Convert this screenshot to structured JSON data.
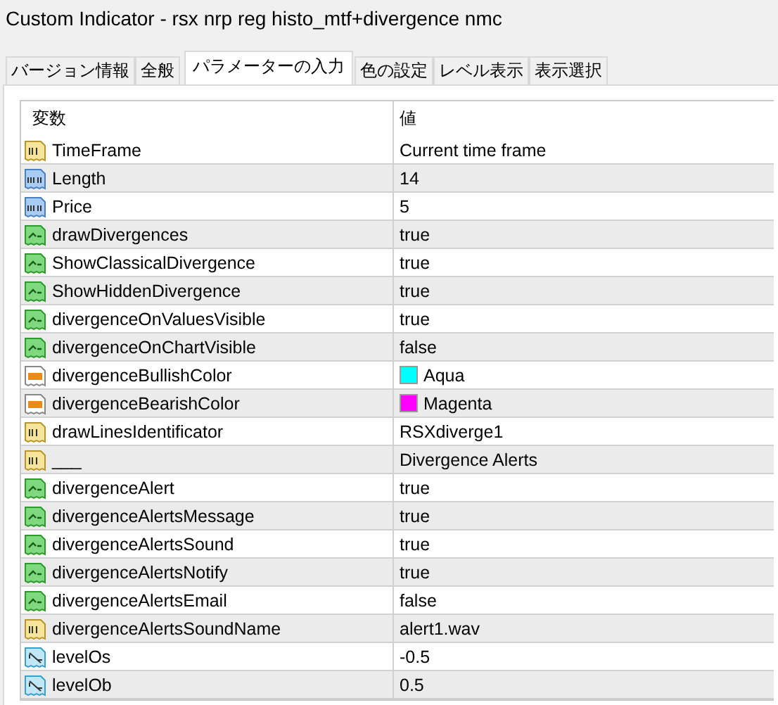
{
  "window": {
    "title": "Custom Indicator - rsx nrp reg histo_mtf+divergence nmc"
  },
  "tabs": [
    {
      "label": "バージョン情報",
      "selected": false
    },
    {
      "label": "全般",
      "selected": false
    },
    {
      "label": "パラメーターの入力",
      "selected": true
    },
    {
      "label": "色の設定",
      "selected": false
    },
    {
      "label": "レベル表示",
      "selected": false
    },
    {
      "label": "表示選択",
      "selected": false
    }
  ],
  "table": {
    "columns": [
      "変数",
      "値"
    ],
    "rows": [
      {
        "kind": "string",
        "name": "TimeFrame",
        "value": "Current time frame"
      },
      {
        "kind": "integer",
        "name": "Length",
        "value": "14"
      },
      {
        "kind": "integer",
        "name": "Price",
        "value": "5"
      },
      {
        "kind": "bool",
        "name": "drawDivergences",
        "value": "true"
      },
      {
        "kind": "bool",
        "name": "ShowClassicalDivergence",
        "value": "true"
      },
      {
        "kind": "bool",
        "name": "ShowHiddenDivergence",
        "value": "true"
      },
      {
        "kind": "bool",
        "name": "divergenceOnValuesVisible",
        "value": "true"
      },
      {
        "kind": "bool",
        "name": "divergenceOnChartVisible",
        "value": "false"
      },
      {
        "kind": "color",
        "name": "divergenceBullishColor",
        "value": "Aqua",
        "color": "#00ffff"
      },
      {
        "kind": "color",
        "name": "divergenceBearishColor",
        "value": "Magenta",
        "color": "#ff00ff"
      },
      {
        "kind": "string",
        "name": "drawLinesIdentificator",
        "value": "RSXdiverge1"
      },
      {
        "kind": "string",
        "name": "___",
        "value": "Divergence Alerts"
      },
      {
        "kind": "bool",
        "name": "divergenceAlert",
        "value": "true"
      },
      {
        "kind": "bool",
        "name": "divergenceAlertsMessage",
        "value": "true"
      },
      {
        "kind": "bool",
        "name": "divergenceAlertsSound",
        "value": "true"
      },
      {
        "kind": "bool",
        "name": "divergenceAlertsNotify",
        "value": "true"
      },
      {
        "kind": "bool",
        "name": "divergenceAlertsEmail",
        "value": "false"
      },
      {
        "kind": "string",
        "name": "divergenceAlertsSoundName",
        "value": "alert1.wav"
      },
      {
        "kind": "double",
        "name": "levelOs",
        "value": "-0.5"
      },
      {
        "kind": "double",
        "name": "levelOb",
        "value": "0.5"
      }
    ]
  }
}
